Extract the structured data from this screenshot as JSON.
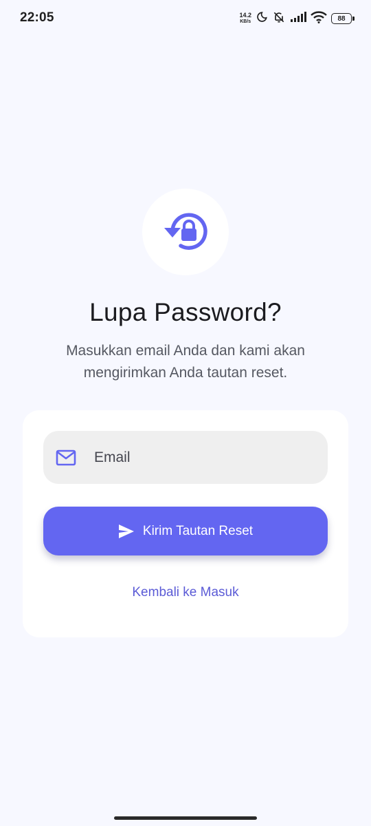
{
  "status_bar": {
    "time": "22:05",
    "net_speed_value": "14.2",
    "net_speed_unit": "KB/s",
    "battery_level": "88",
    "icons": [
      "moon-icon",
      "bell-off-icon",
      "signal-icon",
      "wifi-icon",
      "battery-icon"
    ]
  },
  "hero": {
    "icon": "lock-reset-icon",
    "title": "Lupa Password?",
    "subtitle": "Masukkan email Anda dan kami akan mengirimkan Anda tautan reset."
  },
  "form": {
    "email_placeholder": "Email",
    "email_value": "",
    "email_icon": "mail-icon",
    "submit_label": "Kirim Tautan Reset",
    "submit_icon": "send-icon",
    "back_link_label": "Kembali ke Masuk"
  },
  "colors": {
    "background": "#F7F8FF",
    "accent": "#6366F1",
    "card": "#FFFFFF",
    "input_bg": "#EFEFEF",
    "link": "#5B5BD6"
  }
}
